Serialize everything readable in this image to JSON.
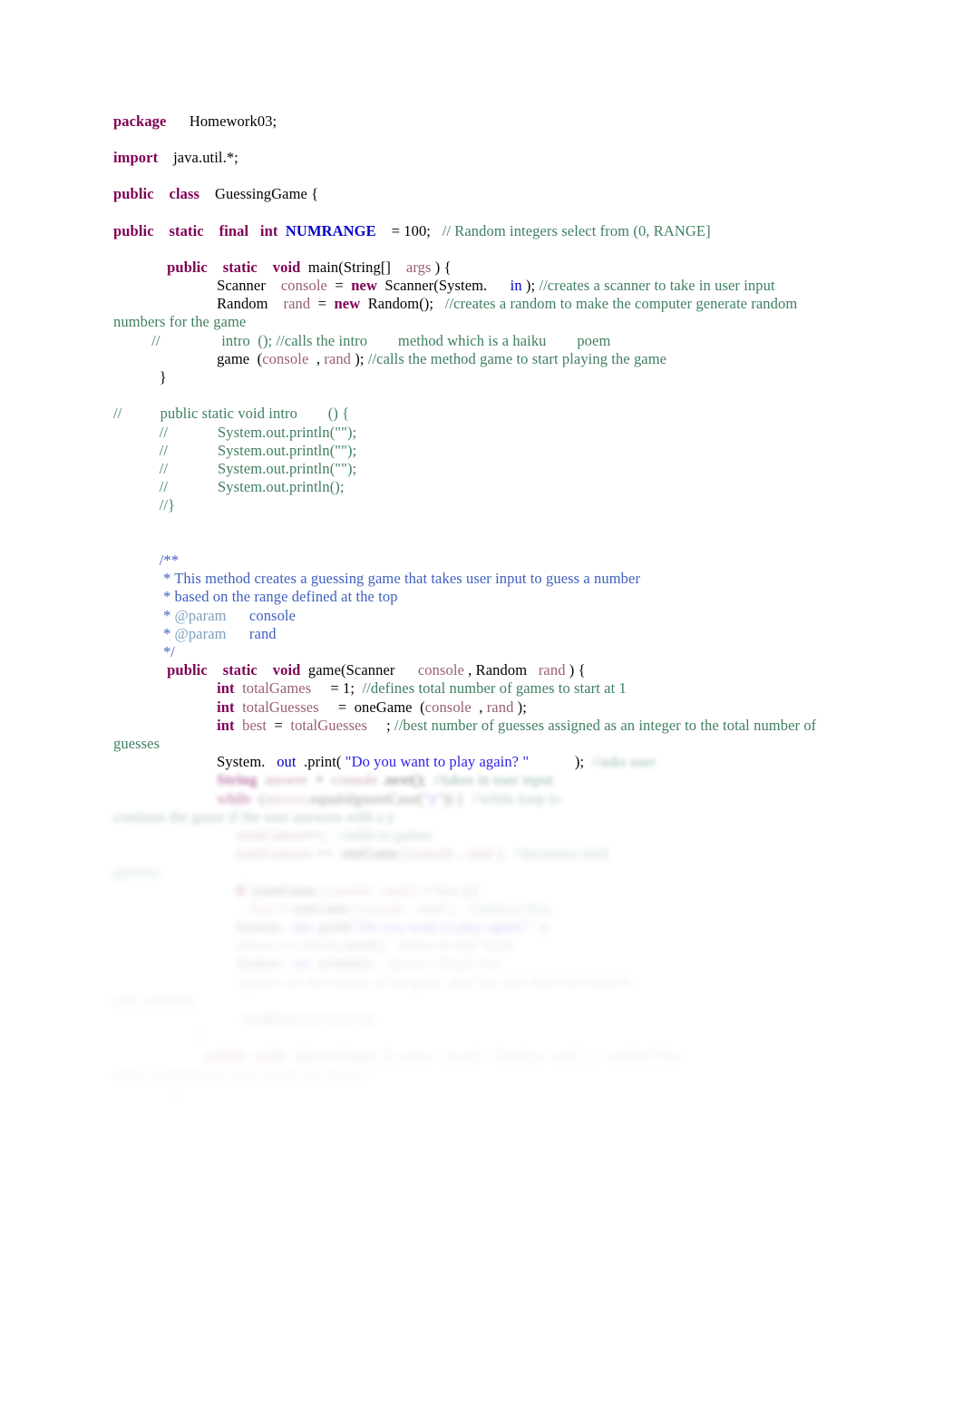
{
  "document": {
    "kind": "java-source-listing",
    "file_class": "GuessingGame",
    "page_background": "#ffffff",
    "colors": {
      "keyword": "#7F0055",
      "comment": "#3F7F5F",
      "javadoc": "#3F5FBF",
      "javadoc_tag": "#7F9FBF",
      "string": "#2A1FE8",
      "constant": "#0000D0",
      "static_field": "#0000C0",
      "variable": "#9A5F72",
      "plain": "#000000"
    }
  },
  "code": {
    "line_1": {
      "kw": "package",
      "rest": "Homework03;"
    },
    "line_2": {
      "kw": "import",
      "rest": "java.util.*;"
    },
    "line_3": {
      "kw1": "public",
      "kw2": "class",
      "rest": "GuessingGame {"
    },
    "line_4": {
      "kw1": "public",
      "kw2": "static",
      "kw3": "final",
      "kw4": "int",
      "const": "NUMRANGE",
      "assign": "= 100;",
      "comment": "// Random integers select from (0, RANGE]"
    },
    "line_5": {
      "kw1": "public",
      "kw2": "static",
      "kw3": "void",
      "sig1": "main(String[]",
      "param": "args",
      "sig2": ") {"
    },
    "line_6": {
      "type": "Scanner",
      "var": "console",
      "eq": "=",
      "kw": "new",
      "ctor": "Scanner(System.",
      "field": "in",
      "tail": ");",
      "comment": "//creates a scanner to take in user input"
    },
    "line_7": {
      "type": "Random",
      "var": "rand",
      "eq": "=",
      "kw": "new",
      "ctor": "Random();",
      "comment": "//creates a random to make the computer generate random numbers for the game"
    },
    "line_8": {
      "slashes": "//",
      "comment": "intro  (); //calls the intro        method which is a haiku        poem"
    },
    "line_9": {
      "call": "game",
      "open": "(",
      "arg1": "console",
      "comma": ",",
      "arg2": "rand",
      "close": ");",
      "comment": "//calls the method game to start playing the game"
    },
    "line_10": {
      "brace": "}"
    },
    "line_11": {
      "comment": "//          public static void intro        () {"
    },
    "line_12": {
      "comment": "//             System.out.println(\"\");"
    },
    "line_13": {
      "comment": "//             System.out.println(\"\");"
    },
    "line_14": {
      "comment": "//             System.out.println(\"\");"
    },
    "line_15": {
      "comment": "//             System.out.println();"
    },
    "line_16": {
      "comment": "//}"
    },
    "line_17": {
      "doc": "/**"
    },
    "line_18": {
      "doc": "* This method creates a guessing game that takes user input to guess a number"
    },
    "line_19": {
      "doc": "* based on the range defined at the top"
    },
    "line_20": {
      "star": "*",
      "tag": "@param",
      "name": "console"
    },
    "line_21": {
      "star": "*",
      "tag": "@param",
      "name": "rand"
    },
    "line_22": {
      "doc": "*/"
    },
    "line_23": {
      "kw1": "public",
      "kw2": "static",
      "kw3": "void",
      "sig": "game(Scanner",
      "p1": "console",
      "comma": ", Random",
      "p2": "rand",
      "close": ") {"
    },
    "line_24": {
      "kw": "int",
      "var": "totalGames",
      "assign": "= 1;",
      "comment": "//defines total number of games to start at 1"
    },
    "line_25": {
      "kw": "int",
      "var": "totalGuesses",
      "eq": "=",
      "call": "oneGame",
      "open": "(",
      "arg1": "console",
      "comma": ",",
      "arg2": "rand",
      "close": ");"
    },
    "line_26": {
      "kw": "int",
      "var1": "best",
      "eq": "=",
      "var2": "totalGuesses",
      "semi": ";",
      "comment": "//best number of guesses assigned as an integer to the total number of guesses"
    },
    "line_27": {
      "obj": "System.",
      "field": "out",
      "method": ".print(",
      "string": "\"Do you want to play again? \"",
      "close": ");",
      "comment": "//asks user"
    }
  },
  "blurred_region": {
    "note": "Lower portion of the page is progressively blurred and faded out.",
    "lines": [
      {
        "kw": "String",
        "var": "answer",
        "eq": "=",
        "obj": "console",
        "method": ".next",
        "call": "();",
        "comment": "//takes in user input"
      },
      {
        "kw": "while",
        "open": "(",
        "var": "answer",
        "method": ".equalsIgnoreCase",
        "arg": "(",
        "string": "\"y\"",
        "close": ")) {",
        "comment": "//while loop to"
      },
      {
        "comment": "continue the game if the user answers with a y"
      },
      {
        "var": "totalGames",
        "op": "++;",
        "comment": "//adds to games"
      },
      {
        "var": "totalGuesses",
        "op": "+=",
        "call": "oneGame",
        "args": "(console , rand );",
        "comment": "//increases total"
      },
      {
        "comment": "guesses"
      },
      {
        "kw": "if",
        "open": "(",
        "call": "oneGame",
        "args": "(console , rand )",
        "op": "<",
        "var": "best",
        "close": ") {"
      },
      {
        "var1": "best",
        "eq": "=",
        "call": "oneGame",
        "args": "(console , rand );",
        "comment": "//replaces best"
      },
      {
        "obj": "System.",
        "field": "out",
        "method": ".print(",
        "string": "\"Do you want to play again? \"",
        "close": ");"
      },
      {
        "var": "answer",
        "eq": "=",
        "obj": "console",
        "method": ".next",
        "call": "();",
        "comment": "//takes in user input"
      },
      {
        "obj": "System.",
        "field": "out",
        "method": ".println",
        "call": "();",
        "comment": "//prints a blank line"
      },
      {
        "comment": "//prints out the results of the game after the user does not want to"
      },
      {
        "comment": "play anymore"
      },
      {
        "call": "results",
        "args": "(",
        "var": "totalGames",
        "close": ");"
      },
      {
        "brace": "}"
      },
      {
        "kw": "public",
        "kw2": "static",
        "kw3": "int",
        "call": "oneGame",
        "args": "(Scanner console , Random rand ) {",
        "comment": "//method that"
      },
      {
        "comment": "takes in parameters and returns an integer"
      },
      {
        "brace": "}"
      }
    ]
  }
}
